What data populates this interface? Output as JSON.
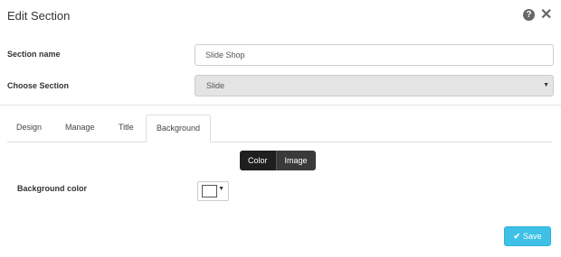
{
  "header": {
    "title": "Edit Section",
    "help_icon": "?",
    "close_icon": "✕"
  },
  "form": {
    "section_name_label": "Section name",
    "section_name_value": "Slide Shop",
    "choose_section_label": "Choose Section",
    "choose_section_value": "Slide",
    "caret": "▼"
  },
  "tabs": [
    {
      "label": "Design",
      "active": false
    },
    {
      "label": "Manage",
      "active": false
    },
    {
      "label": "Title",
      "active": false
    },
    {
      "label": "Background",
      "active": true
    }
  ],
  "background": {
    "toggle": [
      {
        "label": "Color",
        "active": true
      },
      {
        "label": "Image",
        "active": false
      }
    ],
    "color_label": "Background color",
    "color_value": "#ffffff",
    "caret": "▼"
  },
  "footer": {
    "save_label": "Save",
    "save_icon": "✔",
    "save_color": "#3fc0e6"
  }
}
